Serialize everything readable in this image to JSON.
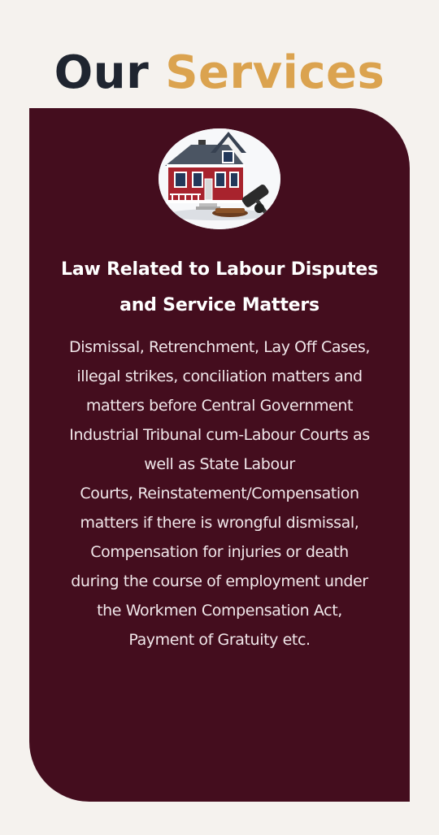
{
  "section": {
    "heading_part1": "Our",
    "heading_part2": "Services"
  },
  "service_card": {
    "icon": "house-gavel-icon",
    "title_lines": [
      "Law Related to Labour Disputes",
      "and Service Matters"
    ],
    "description_lines": [
      "Dismissal, Retrenchment, Lay Off Cases,",
      "illegal strikes, conciliation matters and",
      "matters before Central Government",
      "Industrial Tribunal cum-Labour Courts as",
      "well as State Labour",
      "Courts, Reinstatement/Compensation",
      "matters if there is wrongful dismissal,",
      "Compensation for injuries or death",
      "during the course of employment under",
      "the Workmen Compensation Act,",
      "Payment of Gratuity etc."
    ]
  },
  "colors": {
    "background": "#f5f2ee",
    "heading_dark": "#1f2530",
    "heading_accent": "#dba34f",
    "card_background": "#440d1e",
    "card_text": "#ffffff"
  }
}
